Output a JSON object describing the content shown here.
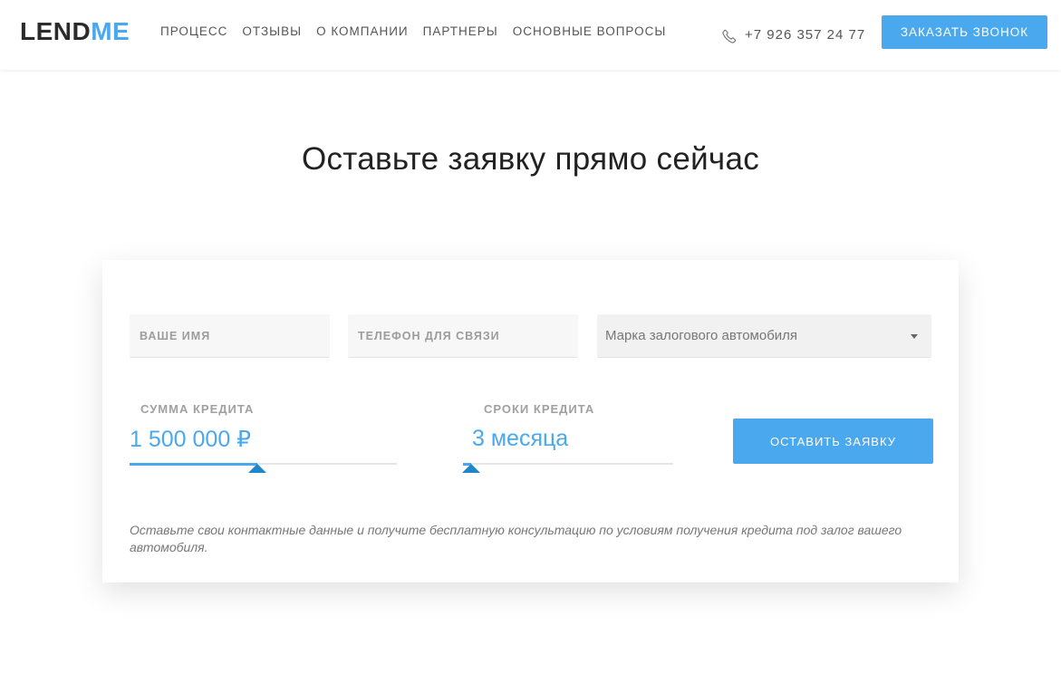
{
  "logo": {
    "part1": "LEND",
    "part2": "ME"
  },
  "nav": {
    "items": [
      "ПРОЦЕСС",
      "ОТЗЫВЫ",
      "О КОМПАНИИ",
      "ПАРТНЕРЫ",
      "ОСНОВНЫЕ ВОПРОСЫ"
    ]
  },
  "header": {
    "phone_icon": "phone-icon",
    "phone": "+7 926 357 24 77",
    "callback_label": "ЗАКАЗАТЬ ЗВОНОК"
  },
  "main": {
    "title": "Оставьте заявку прямо сейчас"
  },
  "form": {
    "name_placeholder": "ВАШЕ ИМЯ",
    "phone_placeholder": "ТЕЛЕФОН ДЛЯ СВЯЗИ",
    "car_select_value": "Марка залогового автомобиля",
    "amount": {
      "label": "СУММА КРЕДИТА",
      "value": "1 500 000 ₽",
      "fraction": 0.46
    },
    "term": {
      "label": "СРОКИ КРЕДИТА",
      "value": "3 месяца",
      "fraction": 0.0
    },
    "submit_label": "ОСТАВИТЬ ЗАЯВКУ",
    "note": "Оставьте свои контактные данные и получите бесплатную консультацию по условиям получения кредита под залог вашего автомобиля."
  },
  "colors": {
    "accent": "#4aa8ef",
    "thumb": "#1f86c9"
  }
}
